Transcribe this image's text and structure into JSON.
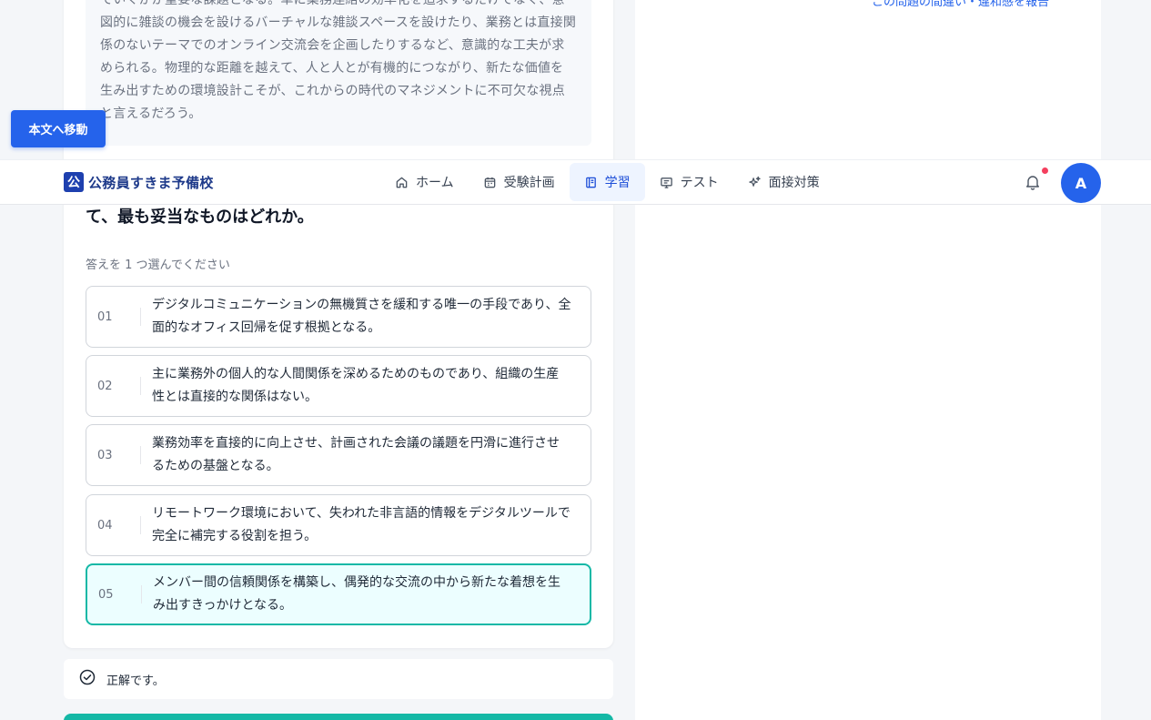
{
  "passage": {
    "lines": [
      "ていくかが重要な課題となる。単に業務連絡の効率化を追求するだけでなく、意",
      "図的に雑談の機会を設けるバーチャルな雑談スペースを設けたり、業務とは直接関",
      "係のないテーマでのオンライン交流会を企画したりするなど、意識的な工夫が求",
      "められる。物理的な距離を越えて、人と人とが有機的につながり、新たな価値を",
      "生み出すための環境設計こそが、これからの時代のマネジメントに不可欠な視点",
      "と言えるだろう。"
    ]
  },
  "report_link": "この問題の間違い・違和感を報告",
  "skip_link": "本文へ移動",
  "header": {
    "logo_mark": "公",
    "logo_text": "公務員すきま予備校",
    "nav": [
      {
        "label": "ホーム",
        "icon": "home-icon"
      },
      {
        "label": "受験計画",
        "icon": "calendar-icon"
      },
      {
        "label": "学習",
        "icon": "book-icon",
        "active": true
      },
      {
        "label": "テスト",
        "icon": "monitor-icon"
      },
      {
        "label": "面接対策",
        "icon": "sparkle-icon"
      }
    ],
    "avatar_initial": "A"
  },
  "question": {
    "tail": "て、最も妥当なものはどれか。",
    "instruction": "答えを 1 つ選んでください"
  },
  "options": [
    {
      "num": "01",
      "lines": [
        "デジタルコミュニケーションの無機質さを緩和する唯一の手段であり、全",
        "面的なオフィス回帰を促す根拠となる。"
      ]
    },
    {
      "num": "02",
      "lines": [
        "主に業務外の個人的な人間関係を深めるためのものであり、組織の生産",
        "性とは直接的な関係はない。"
      ]
    },
    {
      "num": "03",
      "lines": [
        "業務効率を直接的に向上させ、計画された会議の議題を円滑に進行させ",
        "るための基盤となる。"
      ]
    },
    {
      "num": "04",
      "lines": [
        "リモートワーク環境において、失われた非言語的情報をデジタルツールで",
        "完全に補完する役割を担う。"
      ]
    },
    {
      "num": "05",
      "lines": [
        "メンバー間の信頼関係を構築し、偶発的な交流の中から新たな着想を生",
        "み出すきっかけとなる。"
      ],
      "selected": true
    }
  ],
  "feedback": {
    "text": "正解です。"
  },
  "colors": {
    "accent": "#2563eb",
    "selected_border": "#14b8a6",
    "selected_bg": "#ecfeff",
    "notification": "#f43f5e"
  }
}
